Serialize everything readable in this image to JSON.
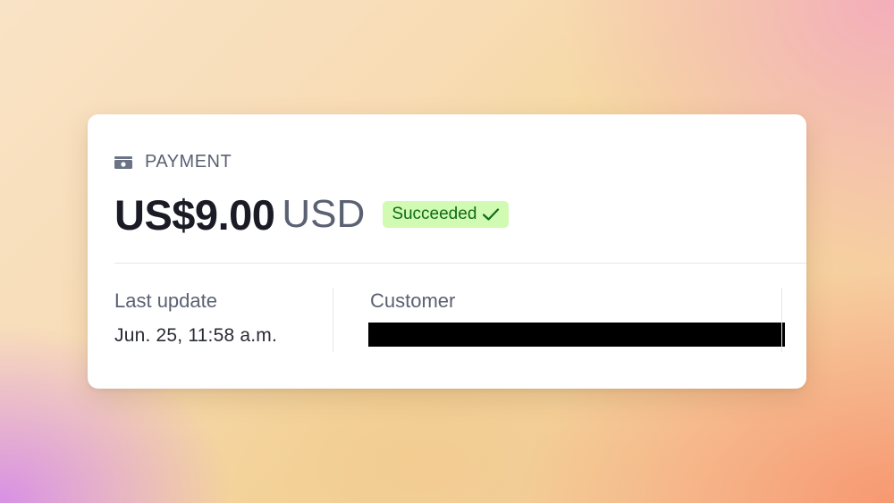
{
  "payment": {
    "header_label": "PAYMENT",
    "header_icon": "payment-card-icon",
    "amount": "US$9.00",
    "currency": "USD",
    "status": "Succeeded",
    "status_icon": "check-icon",
    "colors": {
      "status_bg": "#d1fab3",
      "status_text": "#0f6b1a",
      "muted_text": "#5a6172",
      "amount_text": "#1a1b25"
    }
  },
  "details": {
    "last_update_label": "Last update",
    "last_update_value": "Jun. 25, 11:58 a.m.",
    "customer_label": "Customer"
  }
}
